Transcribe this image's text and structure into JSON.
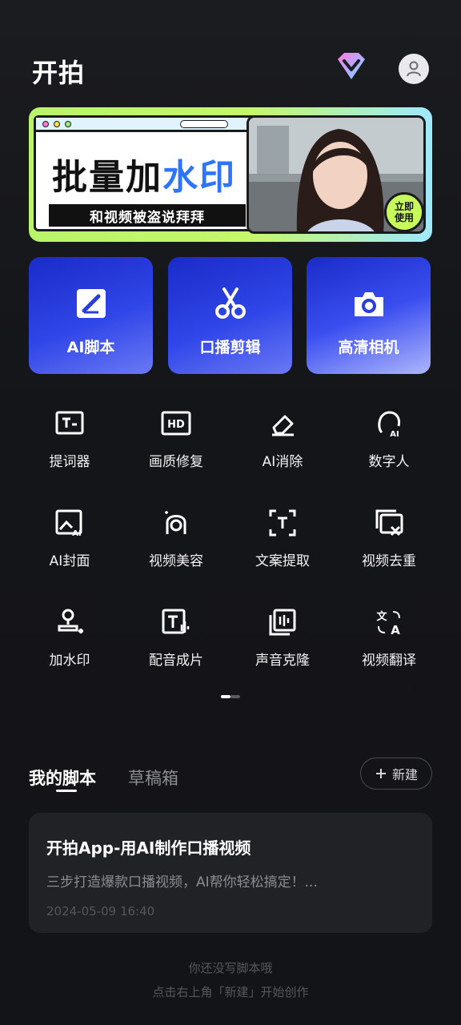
{
  "header": {
    "title": "开拍"
  },
  "banner": {
    "title_main": "批量加",
    "title_highlight": "水印",
    "subtitle": "和视频被盗说拜拜",
    "badge_line1": "立即",
    "badge_line2": "使用"
  },
  "big_cards": [
    {
      "label": "AI脚本",
      "icon": "script-pen-icon"
    },
    {
      "label": "口播剪辑",
      "icon": "scissors-icon"
    },
    {
      "label": "高清相机",
      "icon": "camera-icon"
    }
  ],
  "tools": [
    {
      "label": "提词器",
      "icon": "teleprompter-icon"
    },
    {
      "label": "画质修复",
      "icon": "hd-icon"
    },
    {
      "label": "AI消除",
      "icon": "eraser-icon"
    },
    {
      "label": "数字人",
      "icon": "digital-human-icon"
    },
    {
      "label": "AI封面",
      "icon": "ai-cover-icon"
    },
    {
      "label": "视频美容",
      "icon": "beauty-icon"
    },
    {
      "label": "文案提取",
      "icon": "text-extract-icon"
    },
    {
      "label": "视频去重",
      "icon": "dedupe-icon"
    },
    {
      "label": "加水印",
      "icon": "watermark-icon"
    },
    {
      "label": "配音成片",
      "icon": "voiceover-icon"
    },
    {
      "label": "声音克隆",
      "icon": "voice-clone-icon"
    },
    {
      "label": "视频翻译",
      "icon": "translate-icon"
    }
  ],
  "tabs": {
    "mine": "我的脚本",
    "drafts": "草稿箱"
  },
  "new_button": {
    "icon": "plus-icon",
    "label": "新建"
  },
  "script_card": {
    "title": "开拍App-用AI制作口播视频",
    "desc": "三步打造爆款口播视频，AI帮你轻松搞定！...",
    "time": "2024-05-09 16:40"
  },
  "empty_state": {
    "line1": "你还没写脚本哦",
    "line2": "点击右上角「新建」开始创作"
  },
  "colors": {
    "card_blue": "#2a3de0",
    "bg": "#141518",
    "banner_green": "#c5f76a"
  }
}
